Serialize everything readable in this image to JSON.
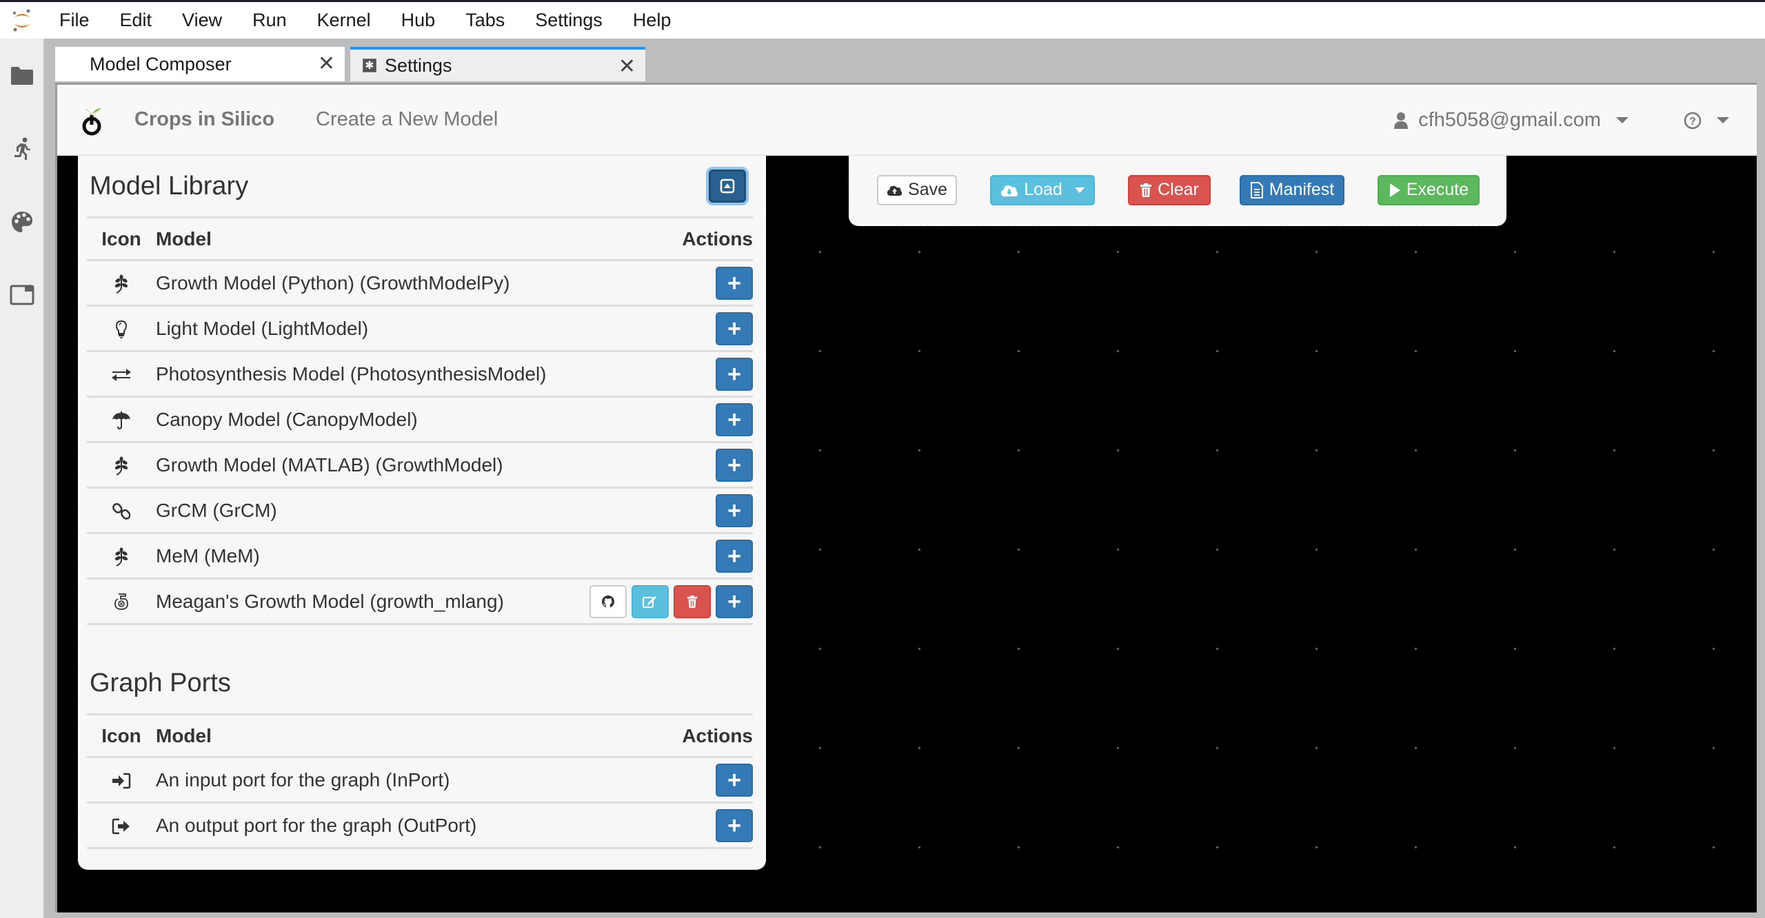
{
  "menubar": {
    "items": [
      "File",
      "Edit",
      "View",
      "Run",
      "Kernel",
      "Hub",
      "Tabs",
      "Settings",
      "Help"
    ]
  },
  "activity_bar": {
    "icons": [
      "folder-icon",
      "running-icon",
      "palette-icon",
      "tabs-icon"
    ]
  },
  "tabs": [
    {
      "label": "Model Composer",
      "active": true
    },
    {
      "label": "Settings",
      "active": false
    }
  ],
  "navbar": {
    "brand": "Crops in Silico",
    "create_link": "Create a New Model",
    "user_email": "cfh5058@gmail.com"
  },
  "toolbar": {
    "save": "Save",
    "load": "Load",
    "clear": "Clear",
    "manifest": "Manifest",
    "execute": "Execute"
  },
  "library": {
    "title": "Model Library",
    "columns": {
      "icon": "Icon",
      "model": "Model",
      "actions": "Actions"
    },
    "models": [
      {
        "icon": "leaf-icon",
        "name": "Growth Model (Python) (GrowthModelPy)",
        "owned": false
      },
      {
        "icon": "lightbulb-icon",
        "name": "Light Model (LightModel)",
        "owned": false
      },
      {
        "icon": "transfer-icon",
        "name": "Photosynthesis Model (PhotosynthesisModel)",
        "owned": false
      },
      {
        "icon": "umbrella-icon",
        "name": "Canopy Model (CanopyModel)",
        "owned": false
      },
      {
        "icon": "leaf-icon",
        "name": "Growth Model (MATLAB) (GrowthModel)",
        "owned": false
      },
      {
        "icon": "link-icon",
        "name": "GrCM (GrCM)",
        "owned": false
      },
      {
        "icon": "leaf-icon",
        "name": "MeM (MeM)",
        "owned": false
      },
      {
        "icon": "html5-icon",
        "name": "Meagan's Growth Model (growth_mlang)",
        "owned": true
      }
    ]
  },
  "graph_ports": {
    "title": "Graph Ports",
    "columns": {
      "icon": "Icon",
      "model": "Model",
      "actions": "Actions"
    },
    "ports": [
      {
        "icon": "sign-in-icon",
        "name": "An input port for the graph (InPort)"
      },
      {
        "icon": "sign-out-icon",
        "name": "An output port for the graph (OutPort)"
      }
    ]
  },
  "colors": {
    "primary": "#337ab7",
    "info": "#5bc0de",
    "danger": "#d9534f",
    "success": "#5cb85c",
    "tab_accent": "#2196f3",
    "jupyter_orange": "#f37626"
  }
}
